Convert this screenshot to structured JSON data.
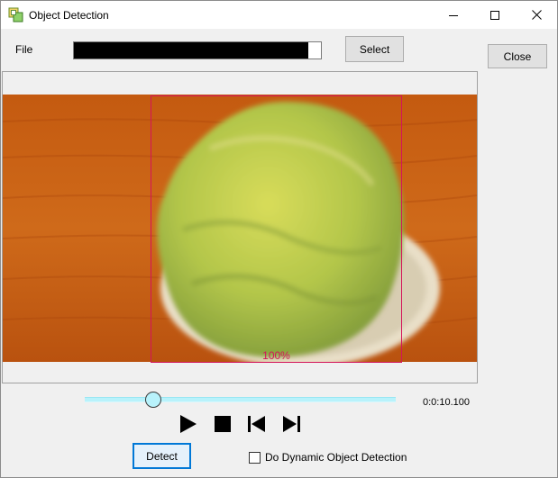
{
  "window": {
    "title": "Object Detection",
    "icon": "object-detection-app-icon"
  },
  "file": {
    "label": "File",
    "progress_fraction": 0.95
  },
  "buttons": {
    "select": "Select",
    "close": "Close",
    "detect": "Detect"
  },
  "detection": {
    "object": "lettuce",
    "confidence": "100%",
    "box_color": "#d4145a"
  },
  "player": {
    "seek_fraction": 0.22,
    "time": "0:0:10.100",
    "controls": [
      "play-icon",
      "stop-icon",
      "skip-previous-icon",
      "skip-next-icon"
    ]
  },
  "options": {
    "dynamic_detection_label": "Do Dynamic Object Detection",
    "dynamic_detection_checked": false
  },
  "colors": {
    "accent": "#0078d7",
    "seek_track": "#b8f2fb"
  }
}
